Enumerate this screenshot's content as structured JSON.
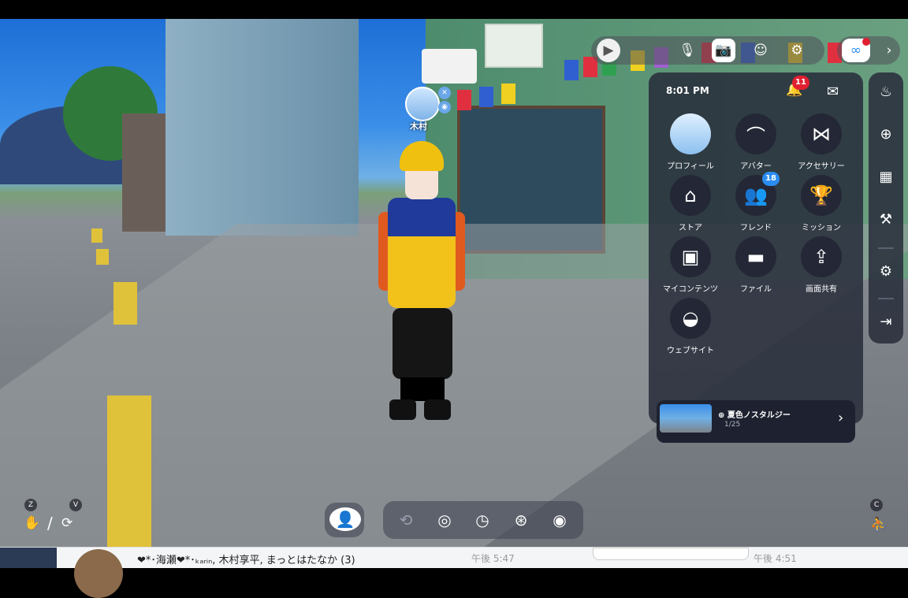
{
  "avatar_name": "木村",
  "toolbar": {
    "play_icon": "▶",
    "mic_icon": "🎙",
    "camera_icon": "📷",
    "emote_icon": "☺",
    "settings_sliders_icon": "⚙",
    "logo_icon": "∞",
    "expand_icon": "›"
  },
  "menu": {
    "time": "8:01 PM",
    "notifications_count": "11",
    "items": [
      {
        "label": "プロフィール",
        "icon": "profile-avatar"
      },
      {
        "label": "アバター",
        "icon": "hanger"
      },
      {
        "label": "アクセサリー",
        "icon": "bow"
      },
      {
        "label": "ストア",
        "icon": "store"
      },
      {
        "label": "フレンド",
        "icon": "friends",
        "badge": "18"
      },
      {
        "label": "ミッション",
        "icon": "trophy"
      },
      {
        "label": "マイコンテンツ",
        "icon": "box"
      },
      {
        "label": "ファイル",
        "icon": "folder"
      },
      {
        "label": "画面共有",
        "icon": "screen-share"
      },
      {
        "label": "ウェブサイト",
        "icon": "web"
      }
    ],
    "world": {
      "name": "夏色ノスタルジー",
      "page": "1/25"
    }
  },
  "bottom": {
    "key_z": "Z",
    "key_v": "V",
    "key_c": "C",
    "slash": "/"
  },
  "strip": {
    "chat_text": "❤*･海瀬❤*･ₖₐᵣᵢₙ, 木村享平, まっとはたなか (3)",
    "time1": "午後 5:47",
    "time2": "午後 4:51"
  },
  "colors": {
    "panel_bg": "#282c3a",
    "badge_red": "#e02030",
    "badge_blue": "#2a8cf0"
  }
}
